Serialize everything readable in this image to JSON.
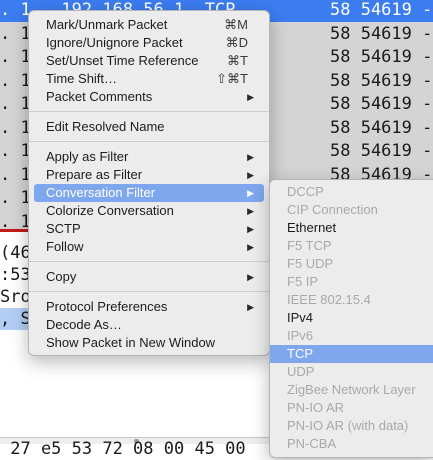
{
  "packet_list": {
    "rows": [
      {
        "left": ". 1…  192.168.56.1  TCP",
        "right": "58 54619 -",
        "selected": true
      },
      {
        "left": ". 1…",
        "right": "58 54619 -",
        "selected": false
      },
      {
        "left": ". 1…",
        "right": "58 54619 -",
        "selected": false
      },
      {
        "left": ". 1…",
        "right": "58 54619 -",
        "selected": false
      },
      {
        "left": ". 1…",
        "right": "58 54619 -",
        "selected": false
      },
      {
        "left": ". 1…",
        "right": "58 54619 -",
        "selected": false
      },
      {
        "left": ". 1…",
        "right": "58 54619 -",
        "selected": false
      },
      {
        "left": ". 1…",
        "right": "58 54619 -",
        "selected": false
      },
      {
        "left": ". 1…",
        "right": "58 54619 -",
        "selected": false
      },
      {
        "left": ". 1…",
        "right": "",
        "selected": false
      }
    ]
  },
  "detail_pane": {
    "lines": [
      {
        "text": "(46",
        "highlight": false
      },
      {
        "text": ":53",
        "highlight": false
      },
      {
        "text": "Sro",
        "highlight": false
      },
      {
        "text": ", S",
        "highlight": true
      }
    ]
  },
  "hex_pane": {
    "line": " 27 e5 53 72 08 00 45 00"
  },
  "context_menu": {
    "groups": [
      [
        {
          "label": "Mark/Unmark Packet",
          "shortcut": "⌘M"
        },
        {
          "label": "Ignore/Unignore Packet",
          "shortcut": "⌘D"
        },
        {
          "label": "Set/Unset Time Reference",
          "shortcut": "⌘T"
        },
        {
          "label": "Time Shift…",
          "shortcut": "⇧⌘T"
        },
        {
          "label": "Packet Comments",
          "submenu": true
        }
      ],
      [
        {
          "label": "Edit Resolved Name"
        }
      ],
      [
        {
          "label": "Apply as Filter",
          "submenu": true
        },
        {
          "label": "Prepare as Filter",
          "submenu": true
        },
        {
          "label": "Conversation Filter",
          "submenu": true,
          "active": true
        },
        {
          "label": "Colorize Conversation",
          "submenu": true
        },
        {
          "label": "SCTP",
          "submenu": true
        },
        {
          "label": "Follow",
          "submenu": true
        }
      ],
      [
        {
          "label": "Copy",
          "submenu": true
        }
      ],
      [
        {
          "label": "Protocol Preferences",
          "submenu": true
        },
        {
          "label": "Decode As…"
        },
        {
          "label": "Show Packet in New Window"
        }
      ]
    ]
  },
  "conversation_submenu": {
    "items": [
      {
        "label": "DCCP",
        "enabled": false
      },
      {
        "label": "CIP Connection",
        "enabled": false
      },
      {
        "label": "Ethernet",
        "enabled": true
      },
      {
        "label": "F5 TCP",
        "enabled": false
      },
      {
        "label": "F5 UDP",
        "enabled": false
      },
      {
        "label": "F5 IP",
        "enabled": false
      },
      {
        "label": "IEEE 802.15.4",
        "enabled": false
      },
      {
        "label": "IPv4",
        "enabled": true
      },
      {
        "label": "IPv6",
        "enabled": false
      },
      {
        "label": "TCP",
        "enabled": true,
        "active": true
      },
      {
        "label": "UDP",
        "enabled": false
      },
      {
        "label": "ZigBee Network Layer",
        "enabled": false
      },
      {
        "label": "PN-IO AR",
        "enabled": false
      },
      {
        "label": "PN-IO AR (with data)",
        "enabled": false
      },
      {
        "label": "PN-CBA",
        "enabled": false
      }
    ]
  },
  "icons": {
    "submenu_arrow": "triangle-right-icon"
  },
  "colors": {
    "selection": "#3b7cf0",
    "menu_highlight": "#7fa7ee",
    "marker_line": "#c21b1b"
  }
}
